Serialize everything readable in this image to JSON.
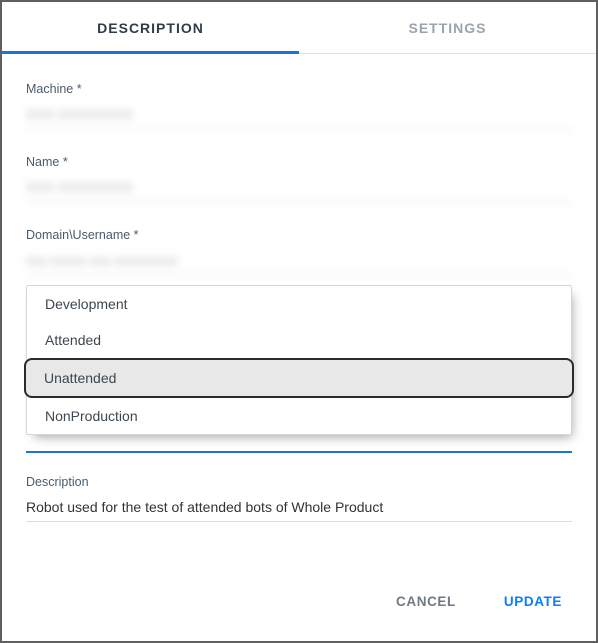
{
  "tabs": {
    "description": "DESCRIPTION",
    "settings": "SETTINGS"
  },
  "fields": {
    "machine": {
      "label": "Machine *",
      "value": "XXX-XXXXXXXX"
    },
    "name": {
      "label": "Name *",
      "value": "XXX-XXXXXXXX"
    },
    "domain_username": {
      "label": "Domain\\Username *",
      "value": "xxx.xxxxx.xxx.xxxxxxxxx"
    },
    "description": {
      "label": "Description",
      "value": "Robot used for the test of attended bots of Whole Product"
    }
  },
  "dropdown": {
    "options": {
      "development": "Development",
      "attended": "Attended",
      "unattended": "Unattended",
      "nonproduction": "NonProduction"
    },
    "selected": "unattended"
  },
  "actions": {
    "cancel": "CANCEL",
    "update": "UPDATE"
  }
}
